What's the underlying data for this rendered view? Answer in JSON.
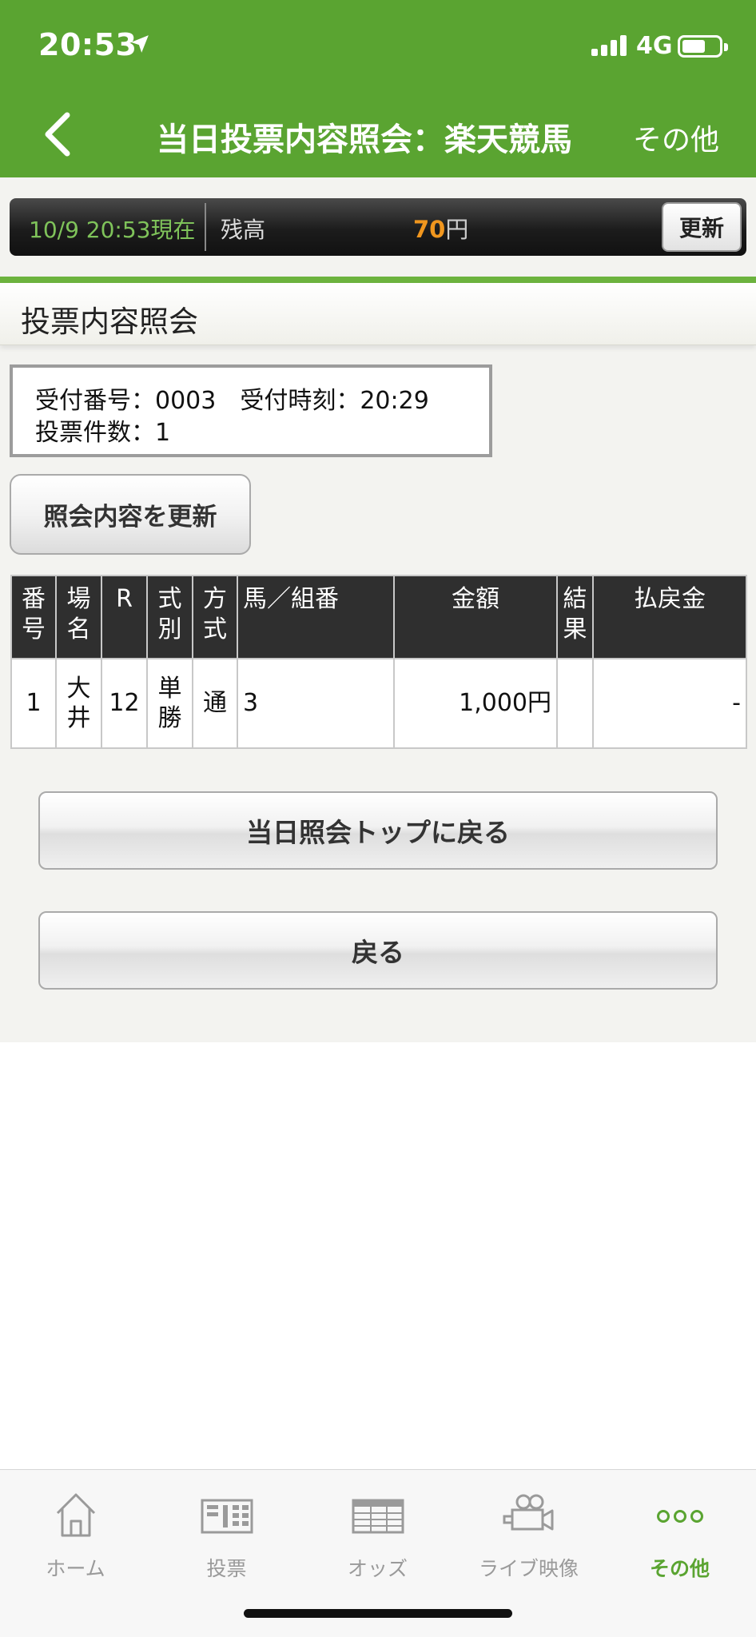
{
  "status_bar": {
    "time": "20:53",
    "network": "4G"
  },
  "nav": {
    "title": "当日投票内容照会：楽天競馬",
    "other": "その他"
  },
  "balance": {
    "datetime": "10/9 20:53現在",
    "label": "残高",
    "amount": "70",
    "unit": "円",
    "refresh": "更新"
  },
  "section": {
    "title": "投票内容照会"
  },
  "receipt": {
    "line1": "受付番号：0003　受付時刻：20:29",
    "line2": "投票件数：1"
  },
  "inquiry_refresh": "照会内容を更新",
  "table": {
    "headers": [
      "番\n号",
      "場\n名",
      "R",
      "式\n別",
      "方\n式",
      "馬／組番",
      "金額",
      "結\n果",
      "払戻金"
    ],
    "rows": [
      {
        "no": "1",
        "venue": "大井",
        "race": "12",
        "type": "単勝",
        "method": "通",
        "horse": "3",
        "amount": "1,000円",
        "result": "",
        "payout": "-"
      }
    ]
  },
  "buttons": {
    "top": "当日照会トップに戻る",
    "back": "戻る"
  },
  "tabs": [
    {
      "label": "ホーム",
      "icon": "home-icon"
    },
    {
      "label": "投票",
      "icon": "ticket-icon"
    },
    {
      "label": "オッズ",
      "icon": "odds-table-icon"
    },
    {
      "label": "ライブ映像",
      "icon": "video-camera-icon"
    },
    {
      "label": "その他",
      "icon": "more-icon"
    }
  ],
  "colors": {
    "brand_green": "#5aa431",
    "balance_orange": "#f0961e"
  }
}
